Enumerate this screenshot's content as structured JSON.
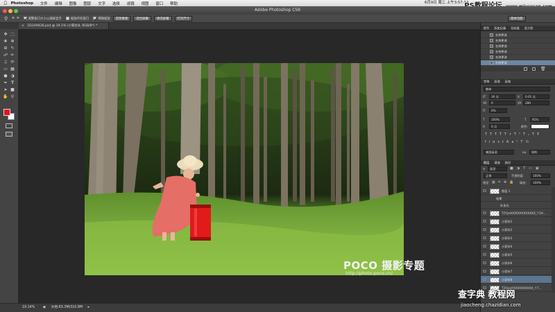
{
  "menubar": {
    "apple_icon": "apple-icon",
    "app": "Photoshop",
    "items": [
      "文件",
      "编辑",
      "图像",
      "图层",
      "文字",
      "选择",
      "滤镜",
      "视图",
      "窗口",
      "帮助"
    ],
    "clock": "6月9日 周二 上午3:57:34"
  },
  "watermark_top": "PS教程论坛",
  "watermark_top_url": "www.missyuan.com",
  "titlebar": {
    "title": "Adobe Photoshop CS6"
  },
  "options": {
    "check1": "调整窗口大小以满屏显示",
    "check2": "缩放所有窗口",
    "check3": "细微缩放",
    "btn1": "实际像素",
    "btn2": "适合屏幕",
    "btn3": "填充屏幕",
    "btn4": "打印尺寸",
    "workspace": "基本功能"
  },
  "document": {
    "tab_title": "1D1A9426.psd @ 19.1% (小家伙8, RGB/8*) *"
  },
  "status": {
    "zoom": "19.14%",
    "doc": "文档:63.3M/310.8M"
  },
  "panels": {
    "history_tabs": [
      "颜色",
      "历史记录",
      "导航器",
      "直方图"
    ],
    "history_items": [
      "名称更改",
      "名称更改",
      "名称更改",
      "名称更改",
      "名称更改",
      "名称更改"
    ],
    "char_tabs": [
      "字符",
      "段落",
      "画笔"
    ],
    "font_family": "楷体",
    "font_size": "30 点",
    "leading": "0.01 点",
    "kerning": "0",
    "tracking": "280",
    "vscale_pct": "0%",
    "hscale": "100%",
    "vscale": "91%",
    "baseline": "0 点",
    "color_label": "颜色:",
    "language": "美国英语",
    "antialias": "锐利",
    "layers_tabs": [
      "图层",
      "通道",
      "路径"
    ],
    "kind": "类型",
    "blend": "正常",
    "opacity_label": "不透明度:",
    "opacity": "100%",
    "fill_label": "填充:",
    "fill": "100%",
    "lock_label": "锁定:",
    "layers": [
      {
        "name": "图层 1"
      },
      {
        "name": "效果"
      },
      {
        "name": "外发光"
      },
      {
        "name": "T2YjmXXfXXXXXXXXXX_!!19..."
      },
      {
        "name": "小家伙1"
      },
      {
        "name": "小家伙2"
      },
      {
        "name": "小家伙3"
      },
      {
        "name": "小家伙4"
      },
      {
        "name": "小家伙5"
      },
      {
        "name": "小家伙6"
      },
      {
        "name": "小家伙7"
      },
      {
        "name": "小家伙8"
      },
      {
        "name": "T2OpqXXXXXXXXXXX_!!7..."
      }
    ]
  },
  "watermark_poco": "POCO 摄影专题",
  "watermark_url": "http://photo.poco.cn/",
  "watermark_br1": "查字典 教程网",
  "watermark_br2": "jiaocheng.chazidian.com"
}
